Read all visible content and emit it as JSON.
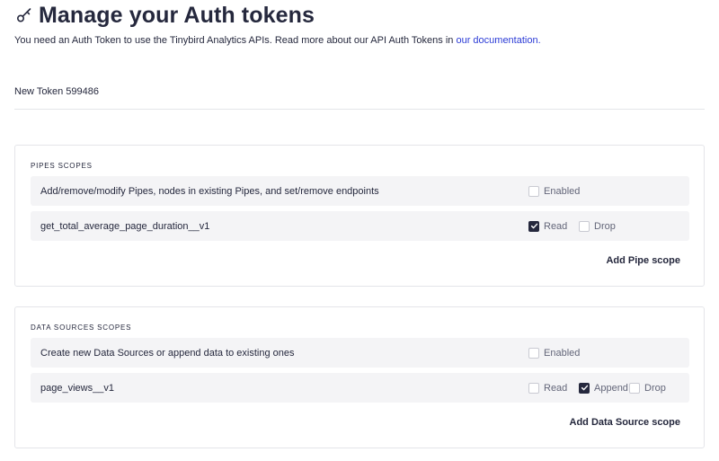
{
  "header": {
    "title": "Manage your Auth tokens",
    "subtitle_text": "You need an Auth Token to use the Tinybird Analytics APIs. Read more about our API Auth Tokens in ",
    "subtitle_link": "our documentation.",
    "icon": "key-icon"
  },
  "token": {
    "name": "New Token 599486"
  },
  "pipes": {
    "label": "PIPES SCOPES",
    "rows": [
      {
        "text": "Add/remove/modify Pipes, nodes in existing Pipes, and set/remove endpoints",
        "options": [
          {
            "label": "Enabled",
            "checked": false
          }
        ]
      },
      {
        "text": "get_total_average_page_duration__v1",
        "options": [
          {
            "label": "Read",
            "checked": true
          },
          {
            "label": "Drop",
            "checked": false
          }
        ]
      }
    ],
    "action": "Add Pipe scope"
  },
  "datasources": {
    "label": "DATA SOURCES SCOPES",
    "rows": [
      {
        "text": "Create new Data Sources or append data to existing ones",
        "options": [
          {
            "label": "Enabled",
            "checked": false
          }
        ]
      },
      {
        "text": "page_views__v1",
        "options": [
          {
            "label": "Read",
            "checked": false
          },
          {
            "label": "Append",
            "checked": true
          },
          {
            "label": "Drop",
            "checked": false
          }
        ]
      }
    ],
    "action": "Add Data Source scope"
  },
  "colors": {
    "text": "#25283d",
    "link": "#2b3bd6",
    "row_bg": "#f4f4f6",
    "border": "#e4e5e9",
    "checkbox_checked": "#25283d"
  }
}
